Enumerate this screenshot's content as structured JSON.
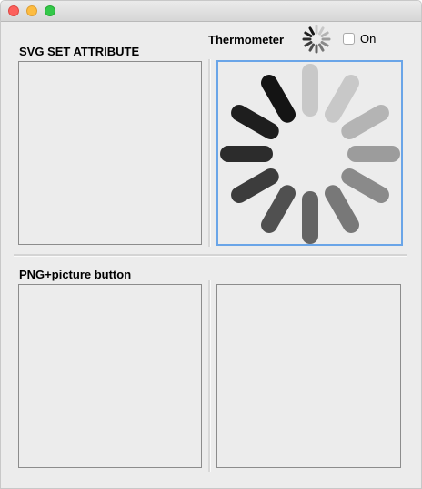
{
  "window": {
    "buttons": [
      "close",
      "minimize",
      "zoom"
    ]
  },
  "svg_section": {
    "title": "SVG SET ATTRIBUTE"
  },
  "thermometer": {
    "label": "Thermometer",
    "checkbox_label": "On",
    "checked": false
  },
  "png_section": {
    "title": "PNG+picture button"
  },
  "spinner": {
    "bar_colors": [
      "#c8c8c8",
      "#c8c8c8",
      "#b4b4b4",
      "#9c9c9c",
      "#8a8a8a",
      "#787878",
      "#646464",
      "#505050",
      "#3c3c3c",
      "#2c2c2c",
      "#1e1e1e",
      "#141414"
    ],
    "focus_color": "#6aa5e8"
  }
}
